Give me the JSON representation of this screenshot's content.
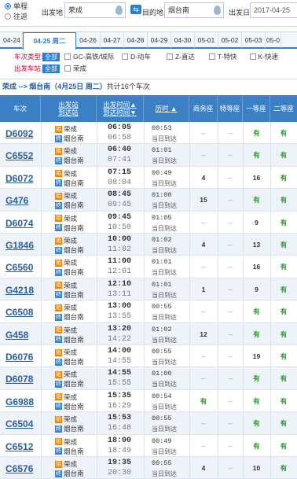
{
  "search": {
    "trip_types": [
      "单程",
      "往返"
    ],
    "from_label": "出发地",
    "from_value": "荣成",
    "swap_icon": "swap-icon",
    "to_label": "目的地",
    "to_value": "烟台南",
    "date_label": "出发日",
    "date_value": "2017-04-25"
  },
  "date_tabs": [
    "04-24",
    "04-25 周二",
    "04-26",
    "04-27",
    "04-28",
    "04-29",
    "04-30",
    "05-01",
    "05-02",
    "05-03",
    "05-0"
  ],
  "active_date_index": 1,
  "filters": {
    "type_label": "车次类型:",
    "station_label": "出发车站:",
    "all_label": "全部",
    "types": [
      "GC-高铁/城际",
      "D-动车",
      "Z-直达",
      "T-特快",
      "K-快速"
    ],
    "stations": [
      "荣成"
    ]
  },
  "summary": {
    "route": "荣成 --> 烟台南",
    "date_text": "（4月25日 周二）",
    "count_text": "共计16个车次"
  },
  "columns": {
    "train": "车次",
    "station_top": "出发站",
    "station_bottom": "到达站",
    "time_top": "出发时间▲",
    "time_bottom": "到达时间▼",
    "duration": "历时 ▲",
    "business": "商务座",
    "special": "特等座",
    "first": "一等座",
    "second": "二等座"
  },
  "badges": {
    "start": "始",
    "end": "终"
  },
  "trains": [
    {
      "no": "D6092",
      "from": "荣成",
      "to": "烟台南",
      "dep": "06:05",
      "arr": "06:58",
      "dur": "00:53",
      "day": "当日到达",
      "business": "--",
      "special": "--",
      "first": "有",
      "second": "有"
    },
    {
      "no": "C6552",
      "from": "荣成",
      "to": "烟台南",
      "dep": "06:40",
      "arr": "07:41",
      "dur": "01:01",
      "day": "当日到达",
      "business": "--",
      "special": "--",
      "first": "有",
      "second": "有"
    },
    {
      "no": "D6072",
      "from": "荣成",
      "to": "烟台南",
      "dep": "07:15",
      "arr": "08:04",
      "dur": "00:49",
      "day": "当日到达",
      "business": "4",
      "special": "--",
      "first": "16",
      "second": "有"
    },
    {
      "no": "G476",
      "from": "荣成",
      "to": "烟台南",
      "dep": "08:45",
      "arr": "09:45",
      "dur": "01:00",
      "day": "当日到达",
      "business": "15",
      "special": "--",
      "first": "有",
      "second": "有"
    },
    {
      "no": "D6074",
      "from": "荣成",
      "to": "烟台南",
      "dep": "09:45",
      "arr": "10:50",
      "dur": "01:05",
      "day": "当日到达",
      "business": "--",
      "special": "--",
      "first": "9",
      "second": "有"
    },
    {
      "no": "G1846",
      "from": "荣成",
      "to": "烟台南",
      "dep": "10:00",
      "arr": "11:02",
      "dur": "01:02",
      "day": "当日到达",
      "business": "4",
      "special": "--",
      "first": "13",
      "second": "有"
    },
    {
      "no": "C6560",
      "from": "荣成",
      "to": "烟台南",
      "dep": "11:00",
      "arr": "12:01",
      "dur": "01:01",
      "day": "当日到达",
      "business": "--",
      "special": "--",
      "first": "16",
      "second": "有"
    },
    {
      "no": "G4218",
      "from": "荣成",
      "to": "烟台南",
      "dep": "12:10",
      "arr": "13:11",
      "dur": "01:01",
      "day": "当日到达",
      "business": "1",
      "special": "--",
      "first": "9",
      "second": "有"
    },
    {
      "no": "C6508",
      "from": "荣成",
      "to": "烟台南",
      "dep": "13:00",
      "arr": "13:55",
      "dur": "00:55",
      "day": "当日到达",
      "business": "--",
      "special": "--",
      "first": "有",
      "second": "有"
    },
    {
      "no": "G458",
      "from": "荣成",
      "to": "烟台南",
      "dep": "13:20",
      "arr": "14:22",
      "dur": "01:02",
      "day": "当日到达",
      "business": "12",
      "special": "--",
      "first": "有",
      "second": "有"
    },
    {
      "no": "D6076",
      "from": "荣成",
      "to": "烟台南",
      "dep": "14:00",
      "arr": "14:55",
      "dur": "00:55",
      "day": "当日到达",
      "business": "--",
      "special": "--",
      "first": "19",
      "second": "有"
    },
    {
      "no": "D6078",
      "from": "荣成",
      "to": "烟台南",
      "dep": "14:55",
      "arr": "15:55",
      "dur": "01:00",
      "day": "当日到达",
      "business": "--",
      "special": "--",
      "first": "有",
      "second": "有"
    },
    {
      "no": "G6988",
      "from": "荣成",
      "to": "烟台南",
      "dep": "15:35",
      "arr": "16:29",
      "dur": "00:54",
      "day": "当日到达",
      "business": "有",
      "special": "--",
      "first": "有",
      "second": "有"
    },
    {
      "no": "C6504",
      "from": "荣成",
      "to": "烟台南",
      "dep": "15:53",
      "arr": "16:48",
      "dur": "00:55",
      "day": "当日到达",
      "business": "--",
      "special": "--",
      "first": "有",
      "second": "有"
    },
    {
      "no": "C6512",
      "from": "荣成",
      "to": "烟台南",
      "dep": "18:00",
      "arr": "18:49",
      "dur": "00:49",
      "day": "当日到达",
      "business": "--",
      "special": "--",
      "first": "有",
      "second": "有"
    },
    {
      "no": "C6576",
      "from": "荣成",
      "to": "烟台南",
      "dep": "19:35",
      "arr": "20:30",
      "dur": "00:55",
      "day": "当日到达",
      "business": "4",
      "special": "--",
      "first": "10",
      "second": "有"
    }
  ],
  "colors": {
    "accent": "#2a7fd4",
    "header": "#3b7fc4",
    "available": "#2a9a2a",
    "start_badge": "#f08300"
  }
}
